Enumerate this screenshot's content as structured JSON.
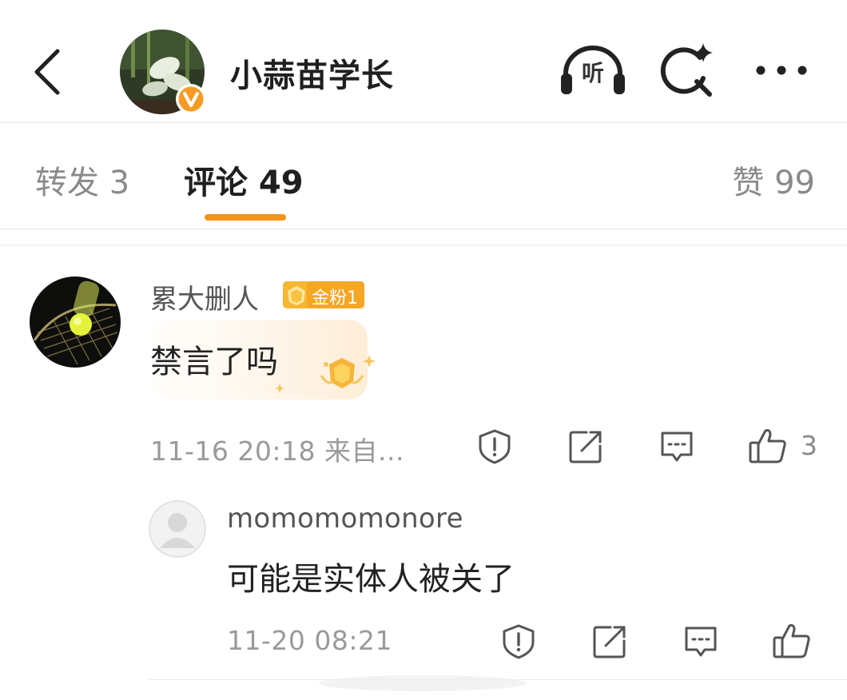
{
  "header": {
    "title": "小蒜苗学长",
    "listen_label": "听",
    "back_icon": "chevron-left-icon",
    "search_icon": "search-sparkle-icon",
    "more_icon": "ellipsis-icon",
    "verified_color": "#f59a23"
  },
  "tabs": {
    "repost": "转发 3",
    "comment": "评论 49",
    "like": "赞 99",
    "active": "comment",
    "accent_color": "#f5921b"
  },
  "comment": {
    "username": "累大删人",
    "fan_badge": "金粉1",
    "text": "禁言了吗",
    "time": "11-16 20:18 来自...",
    "like_count": "3",
    "actions": [
      "report-icon",
      "repost-icon",
      "comment-icon",
      "like-icon"
    ]
  },
  "reply": {
    "username": "momomomonore",
    "text": "可能是实体人被关了",
    "time": "11-20 08:21",
    "actions": [
      "report-icon",
      "repost-icon",
      "comment-icon",
      "like-icon"
    ]
  }
}
